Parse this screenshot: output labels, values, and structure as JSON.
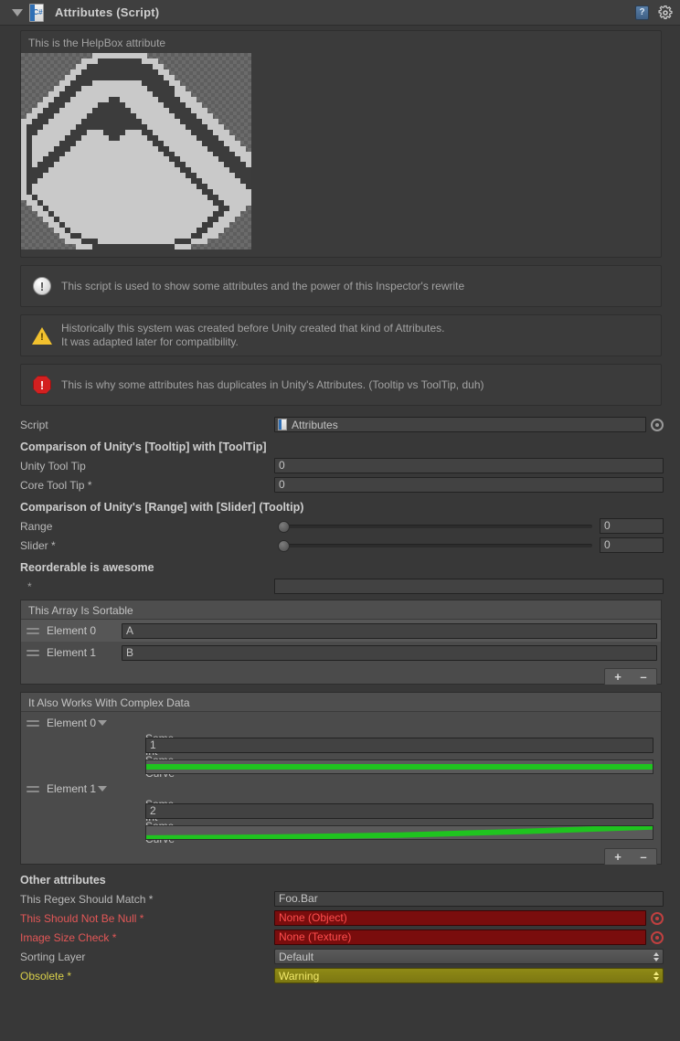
{
  "header": {
    "title": "Attributes (Script)",
    "foldout_icon": "triangle-down-icon",
    "script_icon": "csharp-script-icon",
    "script_icon_glyph": "C#",
    "help_icon": "help-question-icon",
    "help_glyph": "?",
    "gear_icon": "gear-icon"
  },
  "helpbox": {
    "text": "This is the HelpBox attribute",
    "texture_name": "trollface-texture-preview"
  },
  "messages": [
    {
      "type": "info",
      "icon": "info-circle-icon",
      "lines": [
        "This script is used to show some attributes and the power of this Inspector's rewrite"
      ]
    },
    {
      "type": "warning",
      "icon": "warning-triangle-icon",
      "lines": [
        "Historically this system was created before Unity created that kind of Attributes.",
        "It was adapted later for compatibility."
      ]
    },
    {
      "type": "error",
      "icon": "error-octagon-icon",
      "lines": [
        "This is why some attributes has duplicates in Unity's Attributes. (Tooltip vs ToolTip, duh)"
      ]
    }
  ],
  "script_row": {
    "label": "Script",
    "value": "Attributes",
    "picker_icon": "object-picker-icon"
  },
  "tooltip_section": {
    "title": "Comparison of Unity's [Tooltip] with [ToolTip]",
    "rows": [
      {
        "label": "Unity Tool Tip",
        "value": "0"
      },
      {
        "label": "Core Tool Tip *",
        "value": "0"
      }
    ]
  },
  "range_section": {
    "title": "Comparison of Unity's [Range] with [Slider] (Tooltip)",
    "rows": [
      {
        "label": "Range",
        "value": "0",
        "percent": 0
      },
      {
        "label": "Slider *",
        "value": "0",
        "percent": 0
      }
    ]
  },
  "reorderable_section": {
    "title": "Reorderable is awesome",
    "asterisk_label": "*",
    "asterisk_value": ""
  },
  "sortable_list": {
    "header": "This Array Is Sortable",
    "rows": [
      {
        "label": "Element 0",
        "value": "A"
      },
      {
        "label": "Element 1",
        "value": "B"
      }
    ],
    "add_label": "+",
    "remove_label": "–"
  },
  "complex_list": {
    "header": "It Also Works With Complex Data",
    "elements": [
      {
        "label": "Element 0",
        "int_label": "Some Int",
        "int_value": "1",
        "curve_label": "Some Curve",
        "curve_points": [
          [
            0,
            0.5
          ],
          [
            1,
            0.5
          ]
        ]
      },
      {
        "label": "Element 1",
        "int_label": "Some Int",
        "int_value": "2",
        "curve_label": "Some Curve",
        "curve_points": [
          [
            0,
            0.08
          ],
          [
            0.25,
            0.15
          ],
          [
            0.5,
            0.3
          ],
          [
            0.75,
            0.6
          ],
          [
            1,
            0.95
          ]
        ]
      }
    ],
    "add_label": "+",
    "remove_label": "–"
  },
  "other_section": {
    "title": "Other attributes",
    "rows": [
      {
        "label": "This Regex Should Match *",
        "value": "Foo.Bar",
        "kind": "text",
        "state": "normal"
      },
      {
        "label": "This Should Not Be Null *",
        "value": "None (Object)",
        "kind": "object",
        "state": "error"
      },
      {
        "label": "Image Size Check *",
        "value": "None (Texture)",
        "kind": "object",
        "state": "error"
      },
      {
        "label": "Sorting Layer",
        "value": "Default",
        "kind": "dropdown",
        "state": "normal"
      },
      {
        "label": "Obsolete *",
        "value": "Warning",
        "kind": "dropdown",
        "state": "warning"
      }
    ]
  },
  "colors": {
    "background": "#383838",
    "header": "#3f3f3f",
    "field": "#424242",
    "list": "#4b4b4b",
    "error_bg": "#7a0d0d",
    "error_text": "#ff4d4d",
    "warning_bg": "#8f8a16",
    "warning_text": "#f2ea6b",
    "curve_green": "#1fc41f",
    "accent_blue": "#2f6fb5"
  }
}
